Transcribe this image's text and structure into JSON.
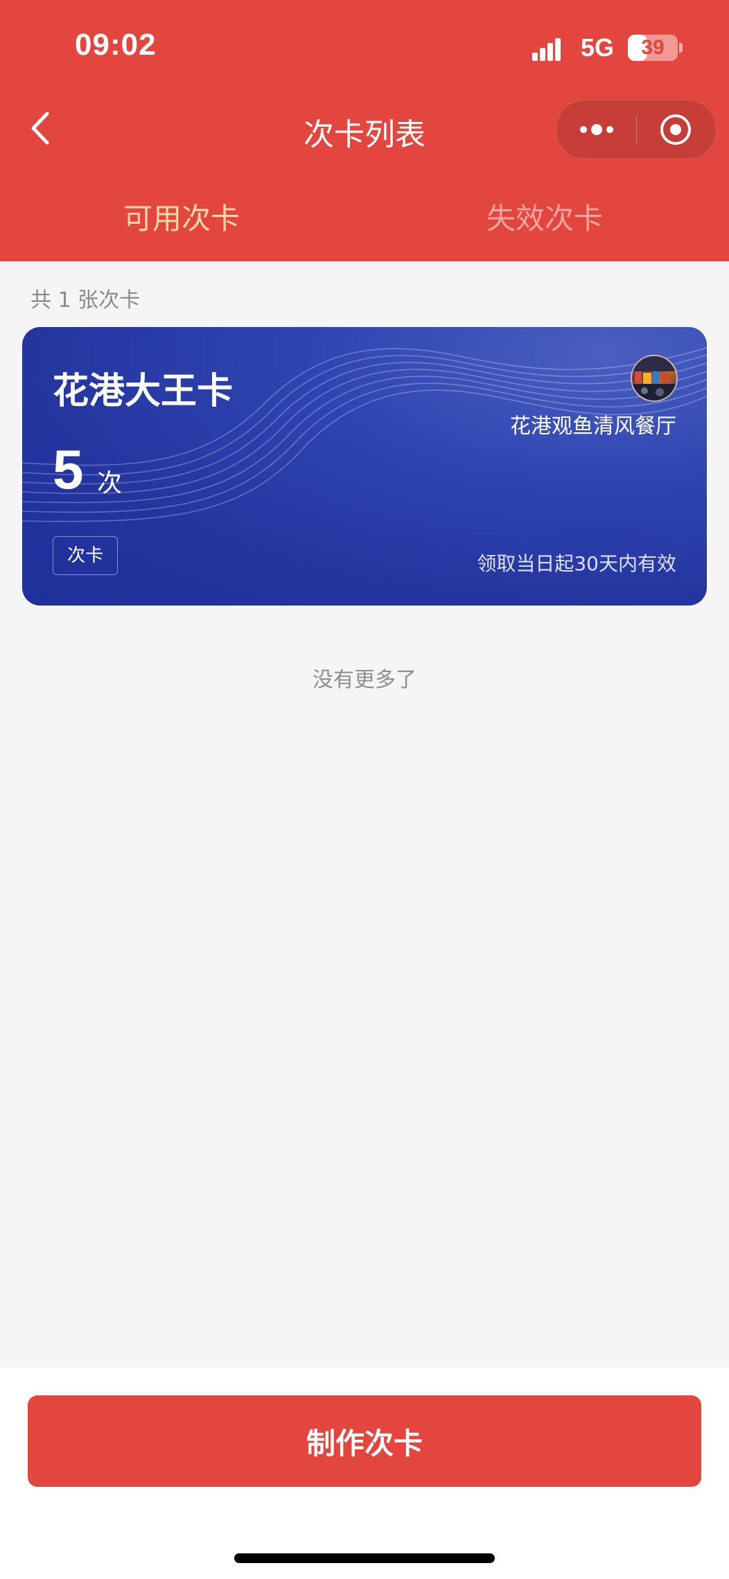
{
  "status_bar": {
    "time": "09:02",
    "network": "5G",
    "battery": "39",
    "battery_level_percent": 39
  },
  "nav": {
    "title": "次卡列表",
    "back_icon": "chevron-left-icon",
    "more_icon": "more-dots-icon",
    "close_icon": "target-circle-icon"
  },
  "tabs": [
    {
      "label": "可用次卡",
      "active": true
    },
    {
      "label": "失效次卡",
      "active": false
    }
  ],
  "list": {
    "count_text": "共 1 张次卡",
    "cards": [
      {
        "name": "花港大王卡",
        "count": "5",
        "count_unit": "次",
        "tag": "次卡",
        "store": "花港观鱼清风餐厅",
        "validity": "领取当日起30天内有效"
      }
    ],
    "end_text": "没有更多了"
  },
  "footer": {
    "create_button": "制作次卡"
  },
  "colors": {
    "brand_red": "#e3463f",
    "active_tab": "#ffd8a8",
    "card_blue": "#2f45b1"
  }
}
